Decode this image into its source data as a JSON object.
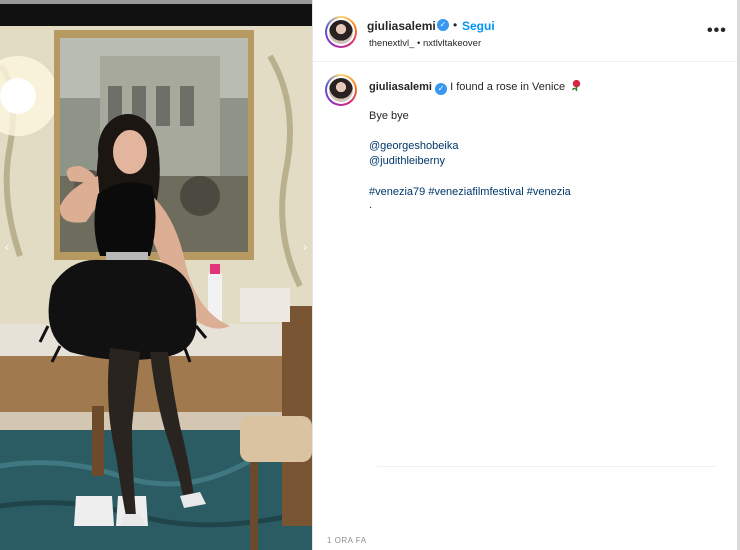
{
  "post": {
    "author": "giuliasalemi",
    "follow_label": "Segui",
    "separator": "•",
    "subline": "thenextlvl_ • nxtlvltakeover",
    "more_label": "•••",
    "caption": {
      "author": "giuliasalemi",
      "text": "I found a rose in Venice",
      "line2": "Bye bye",
      "mention1": "@georgeshobeika",
      "mention2": "@judithleiberny",
      "hashtags": "#venezia79 #veneziafilmfestival #venezia",
      "trailing": "."
    },
    "timestamp": "1 ORA FA",
    "nav_prev": "‹",
    "nav_next": "›"
  },
  "colors": {
    "link": "#00376b",
    "follow": "#0095f6",
    "verified": "#3897f0"
  },
  "icons": [
    "verified-badge-icon",
    "more-options-icon",
    "rose-emoji-icon"
  ]
}
